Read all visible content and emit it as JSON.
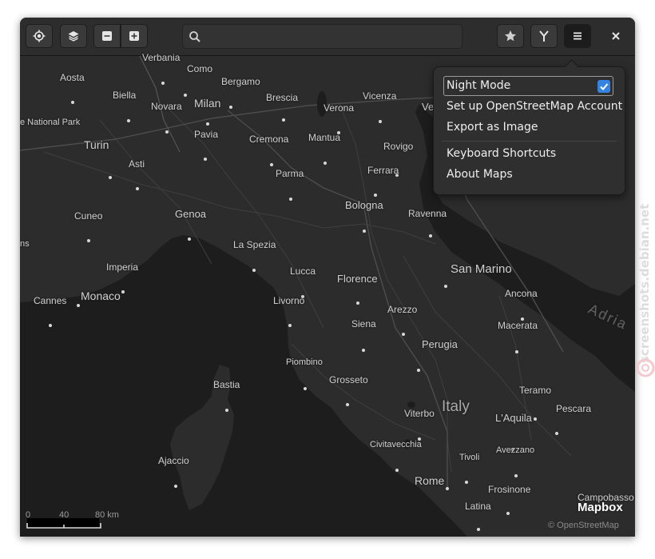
{
  "window": {
    "header": {
      "search": {
        "value": "",
        "placeholder": ""
      },
      "icons": {
        "locate": "locate-icon",
        "layers": "layers-icon",
        "zoom_out": "zoom-out-icon",
        "zoom_in": "zoom-in-icon",
        "search": "search-icon",
        "favorites": "star-icon",
        "route": "route-icon",
        "menu": "hamburger-menu-icon",
        "close": "close-icon"
      }
    },
    "menu": {
      "night_mode": "Night Mode",
      "night_mode_checked": true,
      "osm_account": "Set up OpenStreetMap Account",
      "export_image": "Export as Image",
      "keyboard_shortcuts": "Keyboard Shortcuts",
      "about": "About Maps"
    }
  },
  "map": {
    "colors": {
      "land": "#2b2b2b",
      "sea": "#1d1d1d",
      "roads": "#4a4a4a",
      "label": "#cfcfcf"
    },
    "labels": {
      "verbania": "Verbania",
      "como": "Como",
      "aosta": "Aosta",
      "bergamo": "Bergamo",
      "biella": "Biella",
      "brescia": "Brescia",
      "verona": "Verona",
      "vicenza": "Vicenza",
      "venice_cut": "Ve",
      "novara": "Novara",
      "milan": "Milan",
      "national_park": "e National Park",
      "pavia": "Pavia",
      "cremona": "Cremona",
      "mantua": "Mantua",
      "rovigo": "Rovigo",
      "turin": "Turin",
      "asti": "Asti",
      "parma": "Parma",
      "ferrara": "Ferrara",
      "bologna": "Bologna",
      "ravenna": "Ravenna",
      "cuneo": "Cuneo",
      "genoa": "Genoa",
      "la_spezia": "La Spezia",
      "imperia": "Imperia",
      "lucca": "Lucca",
      "san_marino": "San Marino",
      "florence": "Florence",
      "ancona": "Ancona",
      "cannes": "Cannes",
      "monaco": "Monaco",
      "livorno": "Livorno",
      "arezzo": "Arezzo",
      "siena": "Siena",
      "macerata": "Macerata",
      "adria": "Adria",
      "perugia": "Perugia",
      "piombino": "Piombino",
      "grosseto": "Grosseto",
      "bastia": "Bastia",
      "teramo": "Teramo",
      "italy": "Italy",
      "pescara": "Pescara",
      "viterbo": "Viterbo",
      "laquila": "L'Aquila",
      "civitavecchia": "Civitavecchia",
      "avezzano": "Avezzano",
      "ajaccio": "Ajaccio",
      "tivoli": "Tivoli",
      "rome": "Rome",
      "frosinone": "Frosinone",
      "campobasso": "Campobasso",
      "latina": "Latina",
      "ns_cut": "ns"
    },
    "scale": {
      "t0": "0",
      "t40": "40",
      "t80": "80 km"
    },
    "brand": "Mapbox",
    "attribution": "© OpenStreetMap"
  },
  "watermark": "screenshots.debian.net"
}
